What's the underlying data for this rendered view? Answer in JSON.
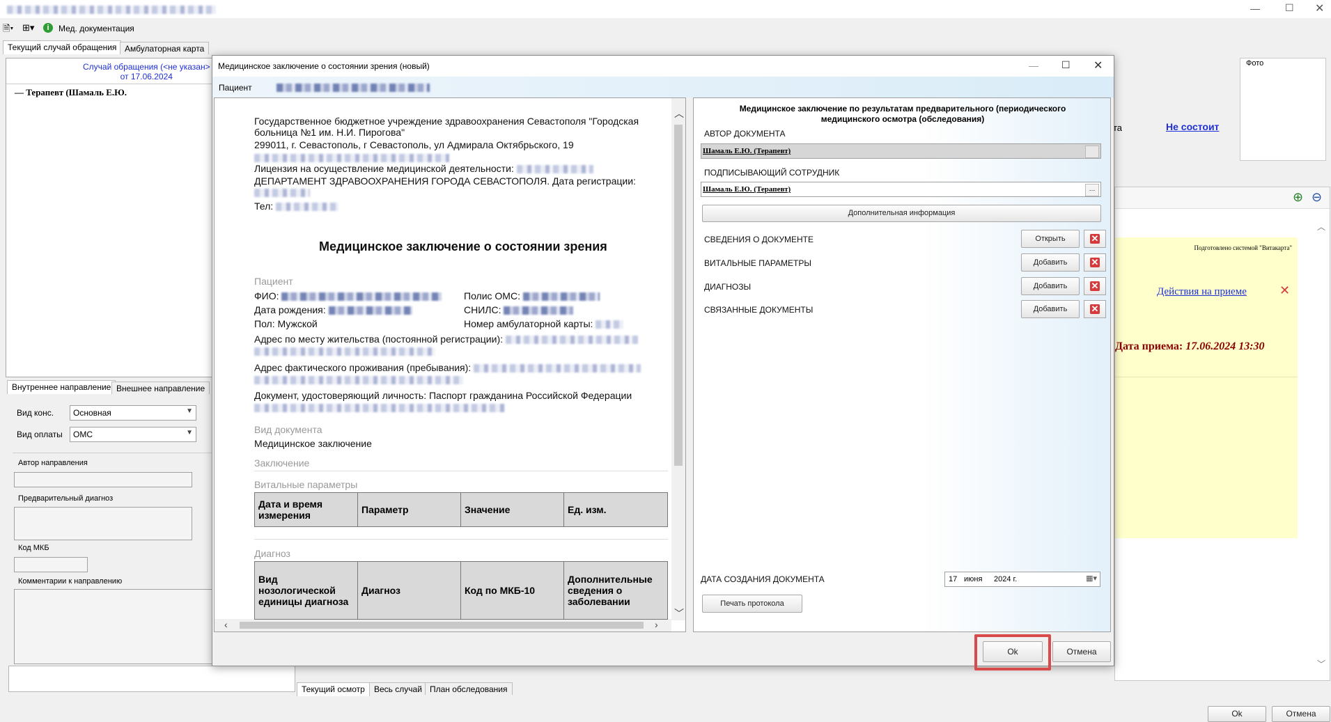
{
  "main_window": {
    "toolbar_med_docs": "Мед. документация",
    "tabs": [
      "Текущий случай обращения",
      "Амбулаторная карта"
    ],
    "case_link_line1": "Случай обращения (<не указан>",
    "case_link_line2": "от 17.06.2024",
    "tree_item": "Терапевт (Шамаль Е.Ю.",
    "direction_tabs": [
      "Внутреннее направление",
      "Внешнее направление"
    ],
    "vid_kons_label": "Вид конс.",
    "vid_kons_value": "Основная",
    "vid_oplaty_label": "Вид оплаты",
    "vid_oplaty_value": "ОМС",
    "author_dir_label": "Автор направления",
    "prelim_diag_label": "Предварительный диагноз",
    "mkb_label": "Код МКБ",
    "comments_label": "Комментарии к направлению",
    "photo_label": "Фото",
    "status_partial": "та",
    "status_link": "Не состоит",
    "prepared_by": "Подготовлено системой \"Витакарта\"",
    "actions_link": "Действия на приеме",
    "visit_date_label": "Дата приема:",
    "visit_date_value": "17.06.2024 13:30",
    "bottom_tabs": [
      "Текущий осмотр",
      "Весь случай",
      "План обследования"
    ],
    "ok_label": "Ok",
    "cancel_label": "Отмена"
  },
  "dialog": {
    "title": "Медицинское заключение о состоянии зрения (новый)",
    "patient_label": "Пациент",
    "ok_label": "Ok",
    "cancel_label": "Отмена",
    "document": {
      "org_line1": "Государственное бюджетное учреждение здравоохранения Севастополя \"Городская",
      "org_line2": "больница №1 им. Н.И. Пирогова\"",
      "address": "299011, г. Севастополь, г Севастополь, ул Адмирала Октябрьского, 19",
      "license": "Лицензия на осуществление медицинской деятельности:",
      "department": "ДЕПАРТАМЕНТ ЗДРАВООХРАНЕНИЯ ГОРОДА СЕВАСТОПОЛЯ. Дата регистрации:",
      "phone": "Тел:",
      "heading": "Медицинское заключение о состоянии зрения",
      "patient_section": "Пациент",
      "fio": "ФИО:",
      "oms": "Полис ОМС:",
      "birth": "Дата рождения:",
      "snils": "СНИЛС:",
      "sex": "Пол: Мужской",
      "card_no": "Номер амбулаторной карты:",
      "addr_reg": "Адрес по месту жительства (постоянной регистрации):",
      "addr_fact": "Адрес фактического проживания (пребывания):",
      "identity_doc": "Документ, удостоверяющий личность: Паспорт гражданина Российской Федерации",
      "doc_type_label": "Вид документа",
      "doc_type_value": "Медицинское заключение",
      "conclusion_label": "Заключение",
      "vitals_label": "Витальные параметры",
      "vitals_headers": [
        "Дата и время измерения",
        "Параметр",
        "Значение",
        "Ед. изм."
      ],
      "diag_label": "Диагноз",
      "diag_headers": [
        "Вид нозологической единицы диагноза",
        "Диагноз",
        "Код по МКБ-10",
        "Дополнительные сведения о заболевании"
      ]
    },
    "panel": {
      "title_line1": "Медицинское заключение по результатам предварительного (периодического",
      "title_line2": "медицинского осмотра (обследования)",
      "author_label": "АВТОР ДОКУМЕНТА",
      "author_value": "Шамаль Е.Ю. (Терапевт)",
      "signer_label": "ПОДПИСЫВАЮЩИЙ СОТРУДНИК",
      "signer_value": "Шамаль Е.Ю. (Терапевт)",
      "extra_info_btn": "Дополнительная информация",
      "rows": [
        {
          "label": "СВЕДЕНИЯ О ДОКУМЕНТЕ",
          "button": "Открыть"
        },
        {
          "label": "ВИТАЛЬНЫЕ ПАРАМЕТРЫ",
          "button": "Добавить"
        },
        {
          "label": "ДИАГНОЗЫ",
          "button": "Добавить"
        },
        {
          "label": "СВЯЗАННЫЕ ДОКУМЕНТЫ",
          "button": "Добавить"
        }
      ],
      "date_label": "ДАТА СОЗДАНИЯ ДОКУМЕНТА",
      "date_day": "17",
      "date_month": "июня",
      "date_year": "2024 г.",
      "print_btn": "Печать протокола"
    }
  },
  "colors": {
    "highlight": "#d94a4a",
    "link": "#1f2fd6",
    "dark_red": "#8b0000",
    "yellow_note": "#ffffcc"
  }
}
